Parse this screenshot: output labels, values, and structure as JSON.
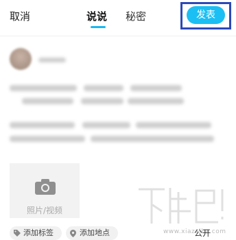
{
  "header": {
    "cancel_label": "取消",
    "tabs": [
      {
        "label": "说说",
        "active": true
      },
      {
        "label": "秘密",
        "active": false
      }
    ],
    "publish_label": "发表"
  },
  "composer": {
    "photo_label": "照片/视频"
  },
  "chips": {
    "add_tag": "添加标签",
    "add_location": "添加地点"
  },
  "visibility": "公开",
  "watermark": {
    "text": "下载吧",
    "domain": "www.xiazaiba.com"
  },
  "colors": {
    "accent": "#1bbff3",
    "highlight_frame": "#2b49b8"
  }
}
